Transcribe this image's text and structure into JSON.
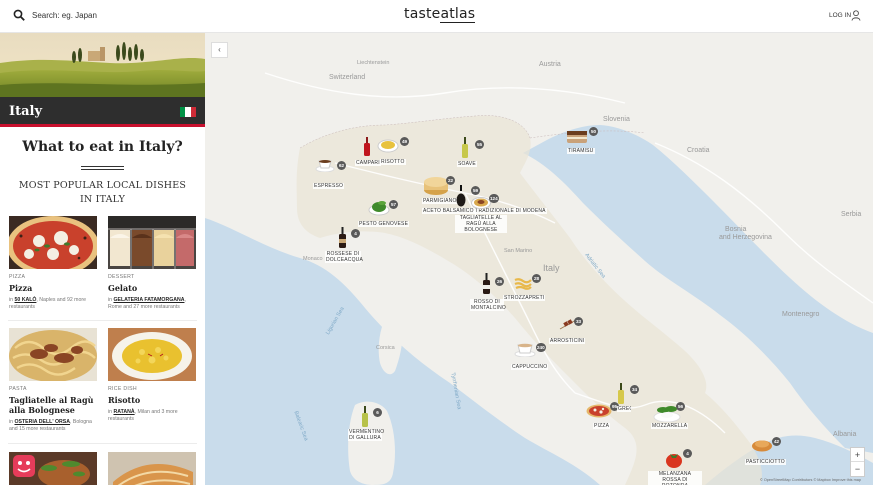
{
  "header": {
    "search_placeholder": "Search: eg. Japan",
    "logo_main": "taste",
    "logo_accent": "atlas",
    "login_label": "LOG IN"
  },
  "sidebar": {
    "country": "Italy",
    "flag_colors": [
      "#009246",
      "#ffffff",
      "#ce2b37"
    ],
    "what_to_eat": "What to eat in Italy?",
    "popular_title": "MOST POPULAR LOCAL DISHES IN ITALY",
    "dishes": [
      {
        "category": "PIZZA",
        "name": "Pizza",
        "where_prefix": "in ",
        "where_place": "50 KALÒ",
        "where_rest": ", Naples and 92 more restaurants"
      },
      {
        "category": "DESSERT",
        "name": "Gelato",
        "where_prefix": "in ",
        "where_place": "GELATERIA FATAMORGANA",
        "where_rest": ", Rome and 27 more restaurants"
      },
      {
        "category": "PASTA",
        "name": "Tagliatelle al Ragù alla Bolognese",
        "where_prefix": "in ",
        "where_place": "OSTERIA DELL' ORSA",
        "where_rest": ", Bologna and 15 more restaurants"
      },
      {
        "category": "RICE DISH",
        "name": "Risotto",
        "where_prefix": "in ",
        "where_place": "RATANÀ",
        "where_rest": ", Milan and 3 more restaurants"
      }
    ]
  },
  "map": {
    "collapse_icon": "‹",
    "geo_labels": [
      {
        "text": "Switzerland",
        "cls": "geo"
      },
      {
        "text": "Liechtenstein",
        "cls": "geo"
      },
      {
        "text": "Austria",
        "cls": "geo"
      },
      {
        "text": "Slovenia",
        "cls": "geo"
      },
      {
        "text": "Croatia",
        "cls": "geo"
      },
      {
        "text": "Bosnia",
        "cls": "geo"
      },
      {
        "text": "and Herzegovina",
        "cls": "geo"
      },
      {
        "text": "Serbia",
        "cls": "geo"
      },
      {
        "text": "Montenegro",
        "cls": "geo"
      },
      {
        "text": "Albania",
        "cls": "geo"
      },
      {
        "text": "Monaco",
        "cls": "geo"
      },
      {
        "text": "San Marino",
        "cls": "geo"
      },
      {
        "text": "Italy",
        "cls": "geo"
      },
      {
        "text": "Corsica",
        "cls": "geo"
      },
      {
        "text": "Adriatic Sea",
        "cls": "sea"
      },
      {
        "text": "Tyrrhenian Sea",
        "cls": "sea"
      },
      {
        "text": "Ligurian Sea",
        "cls": "sea"
      },
      {
        "text": "Balearic Sea",
        "cls": "sea"
      }
    ],
    "markers": [
      {
        "label": "ESPRESSO",
        "count": "62",
        "icon": "espresso-cup-icon"
      },
      {
        "label": "CAMPARI",
        "count": "",
        "icon": "bottle-icon"
      },
      {
        "label": "RISOTTO",
        "count": "49",
        "icon": "risotto-plate-icon"
      },
      {
        "label": "SOAVE",
        "count": "55",
        "icon": "wine-bottle-icon"
      },
      {
        "label": "TIRAMISU",
        "count": "50",
        "icon": "tiramisu-icon"
      },
      {
        "label": "PARMIGIANO",
        "count": "22",
        "icon": "cheese-wheel-icon"
      },
      {
        "label": "ACETO BALSAMICO TRADIZIONALE DI MODENA",
        "count": "59",
        "icon": "balsamic-bottle-icon"
      },
      {
        "label": "TAGLIATELLE AL RAGÙ ALLA BOLOGNESE",
        "count": "124",
        "icon": "pasta-plate-icon"
      },
      {
        "label": "PESTO GENOVESE",
        "count": "57",
        "icon": "pesto-bowl-icon"
      },
      {
        "label": "ROSSESE DI DOLCEACQUA",
        "count": "4",
        "icon": "red-wine-bottle-icon"
      },
      {
        "label": "ROSSO DI MONTALCINO",
        "count": "26",
        "icon": "red-wine-bottle-icon"
      },
      {
        "label": "STROZZAPRETI",
        "count": "28",
        "icon": "pasta-icon"
      },
      {
        "label": "ARROSTICINI",
        "count": "33",
        "icon": "skewer-icon"
      },
      {
        "label": "CAPPUCCINO",
        "count": "240",
        "icon": "cappuccino-cup-icon"
      },
      {
        "label": "VERMENTINO DI GALLURA",
        "count": "6",
        "icon": "white-wine-bottle-icon"
      },
      {
        "label": "PIZZA",
        "count": "95",
        "icon": "pizza-icon"
      },
      {
        "label": "GRECO DI TUFO",
        "count": "34",
        "icon": "white-wine-bottle-icon"
      },
      {
        "label": "MOZZARELLA",
        "count": "56",
        "icon": "mozzarella-icon"
      },
      {
        "label": "PASTICCIOTTO",
        "count": "42",
        "icon": "pastry-icon"
      },
      {
        "label": "MELANZANA ROSSA DI ROTONDA",
        "count": "4",
        "icon": "eggplant-icon"
      }
    ],
    "zoom_in": "+",
    "zoom_out": "−",
    "attribution": "© OpenStreetMap Contributors © Mapbox Improve this map"
  }
}
